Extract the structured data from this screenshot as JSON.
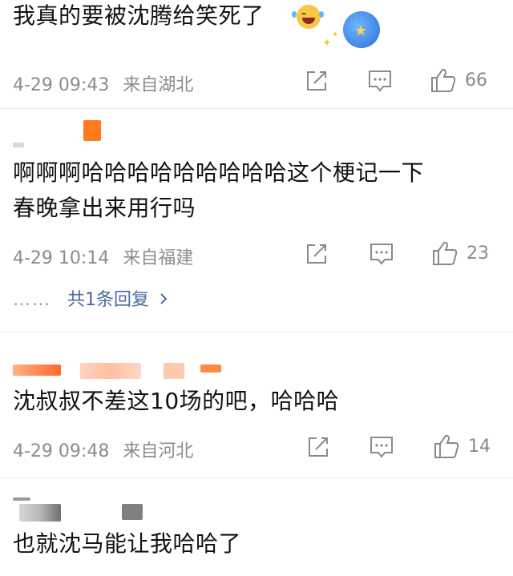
{
  "comments": [
    {
      "text_lines": [
        "我真的要被沈腾给笑死了"
      ],
      "date": "4-29 09:43",
      "source": "来自湖北",
      "likes": "66"
    },
    {
      "text_lines": [
        "啊啊啊哈哈哈哈哈哈哈哈哈这个梗记一下",
        "春晚拿出来用行吗"
      ],
      "date": "4-29 10:14",
      "source": "来自福建",
      "likes": "23",
      "replies_dots": "……",
      "replies_label": "共1条回复"
    },
    {
      "text_lines": [
        "沈叔叔不差这10场的吧，哈哈哈"
      ],
      "date": "4-29 09:48",
      "source": "来自河北",
      "likes": "14"
    },
    {
      "text_lines": [
        "也就沈马能让我哈哈了"
      ]
    }
  ],
  "icons": {
    "emoji": "laughing-tears-emoji",
    "badge": "star-badge",
    "repost": "repost-icon",
    "comment": "comment-icon",
    "like": "thumbs-up-icon",
    "chevron": "chevron-right-icon"
  },
  "colors": {
    "meta": "#8c8c8c",
    "link": "#4a6aa0",
    "divider": "#ececec",
    "avatar_blur": "#ff7a1a"
  }
}
